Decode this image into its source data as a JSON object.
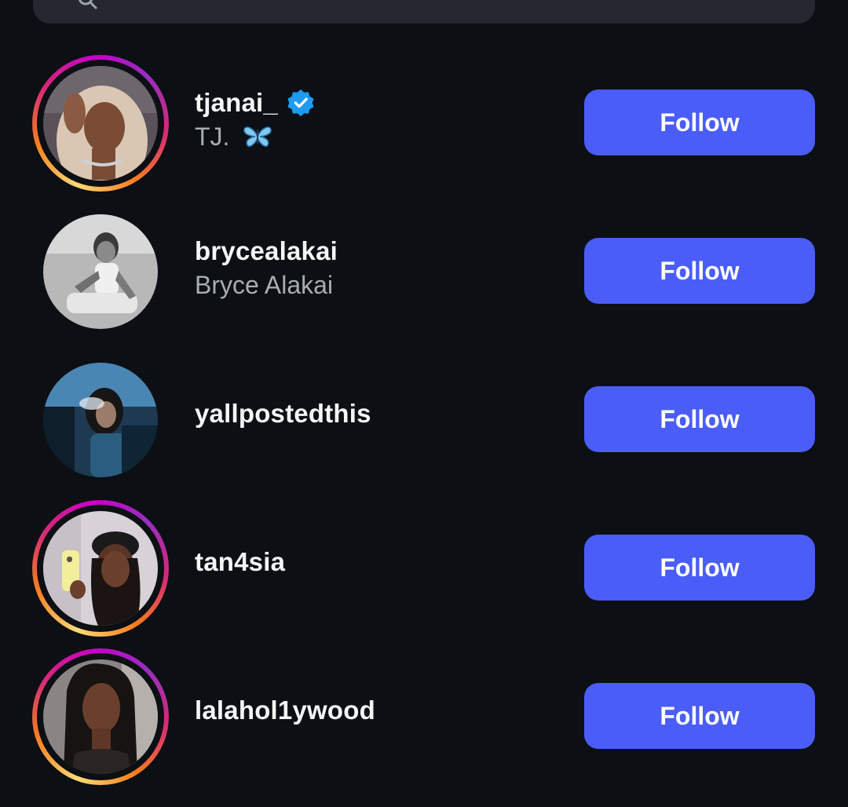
{
  "search": {
    "icon": "search-icon",
    "bar_color": "#25292f"
  },
  "accent_color": "#4a5df9",
  "users": [
    {
      "username": "tjanai_",
      "full_name": "TJ.",
      "verified": true,
      "name_emoji": "butterfly-icon",
      "has_story_ring": true,
      "follow_label": "Follow"
    },
    {
      "username": "brycealakai",
      "full_name": "Bryce Alakai",
      "verified": false,
      "has_story_ring": false,
      "follow_label": "Follow"
    },
    {
      "username": "yallpostedthis",
      "full_name": "",
      "verified": false,
      "has_story_ring": false,
      "follow_label": "Follow"
    },
    {
      "username": "tan4sia",
      "full_name": "",
      "verified": false,
      "has_story_ring": true,
      "follow_label": "Follow"
    },
    {
      "username": "lalahol1ywood",
      "full_name": "",
      "verified": false,
      "has_story_ring": true,
      "follow_label": "Follow"
    }
  ]
}
